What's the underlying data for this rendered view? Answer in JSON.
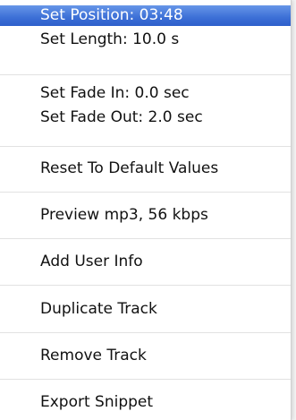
{
  "menu": {
    "items": [
      {
        "label": "Set Position: 03:48"
      },
      {
        "label": "Set Length: 10.0 s"
      },
      {
        "label": "Set Fade In: 0.0 sec"
      },
      {
        "label": "Set Fade Out: 2.0 sec"
      },
      {
        "label": "Reset To Default Values"
      },
      {
        "label": "Preview mp3, 56 kbps"
      },
      {
        "label": "Add User Info"
      },
      {
        "label": "Duplicate Track"
      },
      {
        "label": "Remove Track"
      },
      {
        "label": "Export Snippet"
      }
    ],
    "highlight_color": "#3c6fd6"
  }
}
